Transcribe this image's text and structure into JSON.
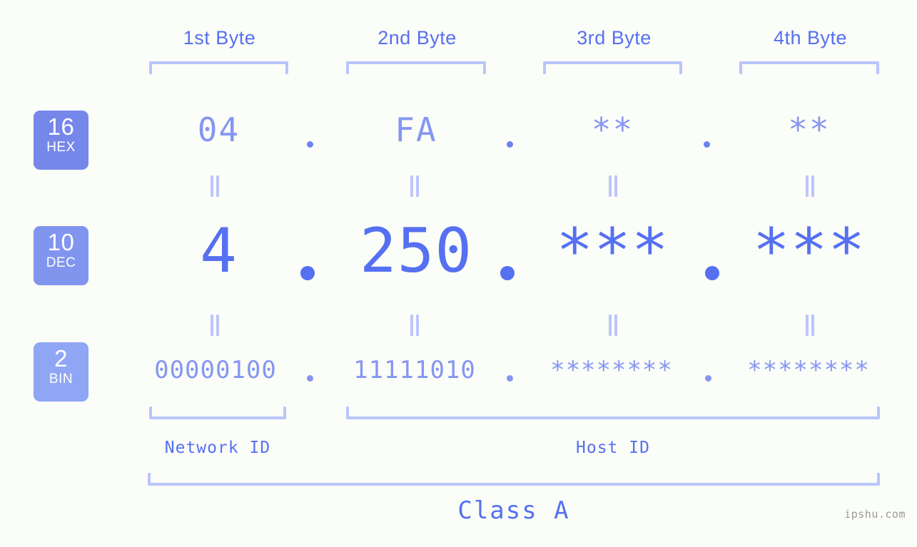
{
  "watermark": "ipshu.com",
  "byte_headers": [
    {
      "label": "1st Byte"
    },
    {
      "label": "2nd Byte"
    },
    {
      "label": "3rd Byte"
    },
    {
      "label": "4th Byte"
    }
  ],
  "radix_badges": [
    {
      "number": "16",
      "name": "HEX",
      "color": "#7687ea"
    },
    {
      "number": "10",
      "name": "DEC",
      "color": "#8195ef"
    },
    {
      "number": "2",
      "name": "BIN",
      "color": "#8fa6f5"
    }
  ],
  "rows": {
    "hex": {
      "radix": "16",
      "radix_name": "HEX",
      "octets": [
        "04",
        "FA",
        "**",
        "**"
      ],
      "separator": "."
    },
    "dec": {
      "radix": "10",
      "radix_name": "DEC",
      "octets": [
        "4",
        "250",
        "***",
        "***"
      ],
      "separator": "."
    },
    "bin": {
      "radix": "2",
      "radix_name": "BIN",
      "octets": [
        "00000100",
        "11111010",
        "********",
        "********"
      ],
      "separator": "."
    }
  },
  "equality_mark": "=",
  "segments": {
    "network_id": "Network ID",
    "host_id": "Host ID",
    "class": "Class A"
  },
  "colors": {
    "background": "#fbfdf8",
    "accent_strong": "#5570f1",
    "accent_mid": "#8596f2",
    "accent_light": "#b9c5fb",
    "badge_hex": "#7687ea",
    "badge_dec": "#8195ef",
    "badge_bin": "#8fa6f5",
    "watermark_text": "#9a9a9a"
  }
}
